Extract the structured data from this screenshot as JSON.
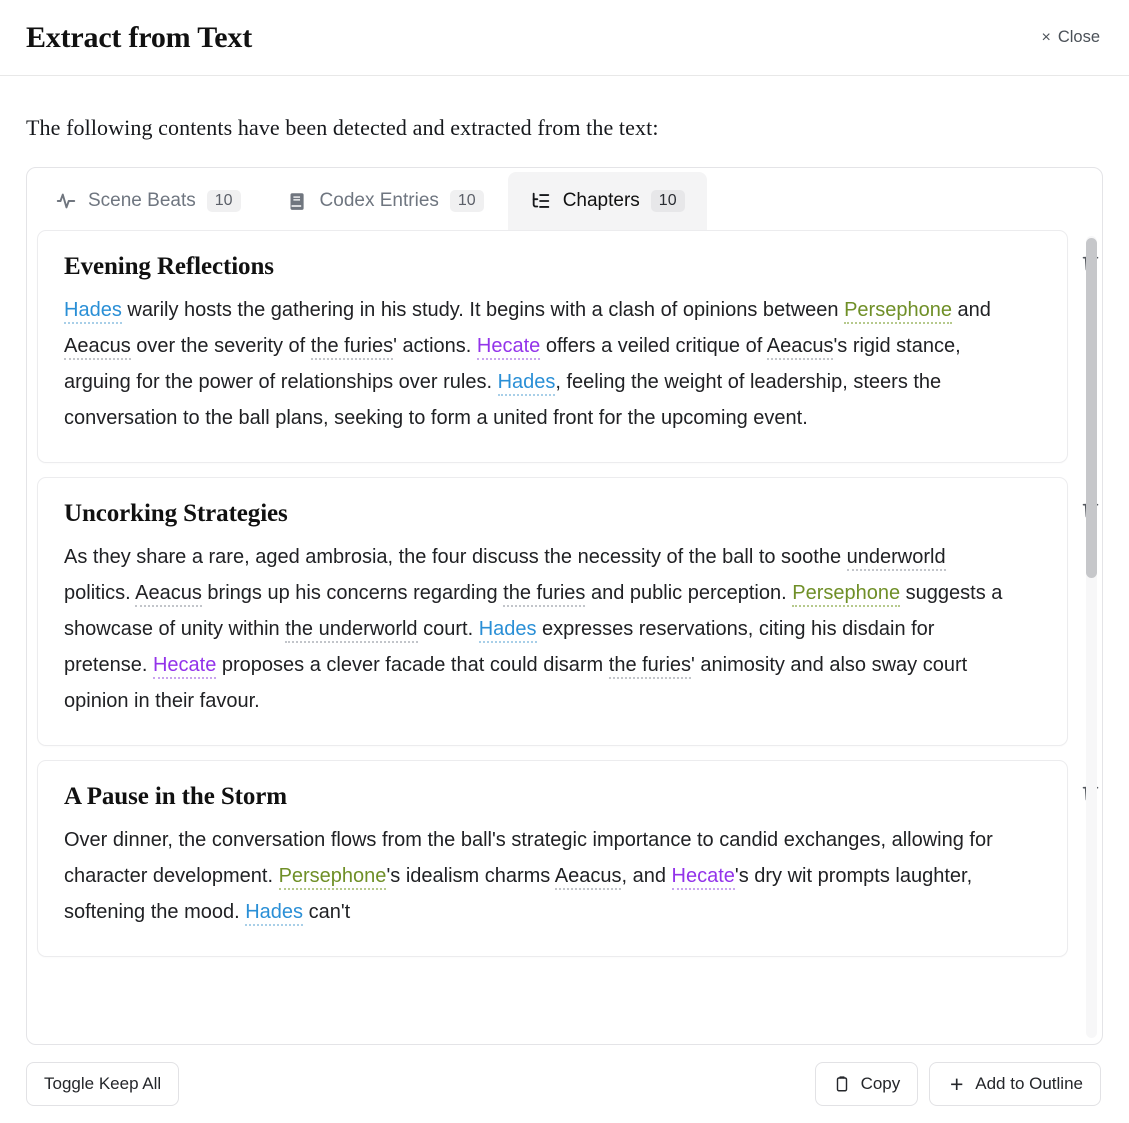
{
  "header": {
    "title": "Extract from Text",
    "close_label": "Close",
    "close_x": "×"
  },
  "intro": "The following contents have been detected and extracted from the text:",
  "tabs": [
    {
      "id": "scene-beats",
      "label": "Scene Beats",
      "count": "10",
      "icon": "activity-pulse-icon",
      "active": false
    },
    {
      "id": "codex-entries",
      "label": "Codex Entries",
      "count": "10",
      "icon": "book-icon",
      "active": false
    },
    {
      "id": "chapters",
      "label": "Chapters",
      "count": "10",
      "icon": "list-tree-icon",
      "active": true
    }
  ],
  "colors": {
    "hades": "#2a8fd6",
    "persephone": "#6f8f27",
    "hecate": "#9333ea",
    "accent_underline": "#b9bcc2",
    "active_tab_bg": "#f4f4f5",
    "active_tab_underline": "#111111"
  },
  "cards": [
    {
      "title": "Evening Reflections",
      "delete_icon": "trash-icon",
      "segments": [
        {
          "t": "Hades",
          "k": "hades"
        },
        {
          "t": " warily hosts the gathering in his study. It begins with a clash of opinions between ",
          "k": ""
        },
        {
          "t": "Persephone",
          "k": "perseph"
        },
        {
          "t": " and ",
          "k": ""
        },
        {
          "t": "Aeacus",
          "k": "plain"
        },
        {
          "t": " over the severity of ",
          "k": ""
        },
        {
          "t": "the furies",
          "k": "plain"
        },
        {
          "t": "' actions. ",
          "k": ""
        },
        {
          "t": "Hecate",
          "k": "hecate"
        },
        {
          "t": " offers a veiled critique of ",
          "k": ""
        },
        {
          "t": "Aeacus",
          "k": "plain"
        },
        {
          "t": "'s rigid stance, arguing for the power of relationships over rules. ",
          "k": ""
        },
        {
          "t": "Hades",
          "k": "hades"
        },
        {
          "t": ", feeling the weight of leadership, steers the conversation to the ball plans, seeking to form a united front for the upcoming event.",
          "k": ""
        }
      ]
    },
    {
      "title": "Uncorking Strategies",
      "delete_icon": "trash-icon",
      "segments": [
        {
          "t": "As they share a rare, aged ambrosia, the four discuss the necessity of the ball to soothe ",
          "k": ""
        },
        {
          "t": "underworld",
          "k": "plain"
        },
        {
          "t": " politics. ",
          "k": ""
        },
        {
          "t": "Aeacus",
          "k": "plain"
        },
        {
          "t": " brings up his concerns regarding ",
          "k": ""
        },
        {
          "t": "the furies",
          "k": "plain"
        },
        {
          "t": " and public perception. ",
          "k": ""
        },
        {
          "t": "Persephone",
          "k": "perseph"
        },
        {
          "t": " suggests a showcase of unity within ",
          "k": ""
        },
        {
          "t": "the underworld",
          "k": "plain"
        },
        {
          "t": " court. ",
          "k": ""
        },
        {
          "t": "Hades",
          "k": "hades"
        },
        {
          "t": " expresses reservations, citing his disdain for pretense. ",
          "k": ""
        },
        {
          "t": "Hecate",
          "k": "hecate"
        },
        {
          "t": " proposes a clever facade that could disarm ",
          "k": ""
        },
        {
          "t": "the furies",
          "k": "plain"
        },
        {
          "t": "' animosity and also sway court opinion in their favour.",
          "k": ""
        }
      ]
    },
    {
      "title": "A Pause in the Storm",
      "delete_icon": "trash-icon",
      "segments": [
        {
          "t": "Over dinner, the conversation flows from the ball's strategic importance to candid exchanges, allowing for character development. ",
          "k": ""
        },
        {
          "t": "Persephone",
          "k": "perseph"
        },
        {
          "t": "'s idealism charms ",
          "k": ""
        },
        {
          "t": "Aeacus",
          "k": "plain"
        },
        {
          "t": ", and ",
          "k": ""
        },
        {
          "t": "Hecate",
          "k": "hecate"
        },
        {
          "t": "'s dry wit prompts laughter, softening the mood. ",
          "k": ""
        },
        {
          "t": "Hades",
          "k": "hades"
        },
        {
          "t": " can't",
          "k": ""
        }
      ]
    }
  ],
  "footer": {
    "toggle_keep_all": "Toggle Keep All",
    "copy": "Copy",
    "copy_icon": "clipboard-icon",
    "add_to_outline": "Add to Outline",
    "add_icon": "plus-icon"
  }
}
